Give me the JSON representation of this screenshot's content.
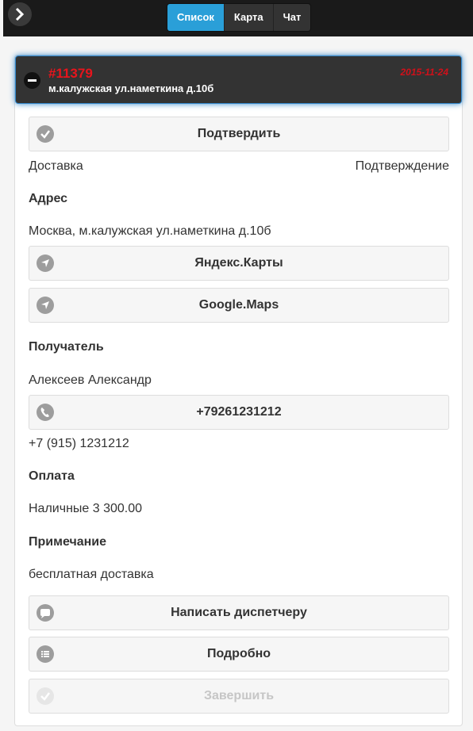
{
  "nav": {
    "tabs": [
      "Список",
      "Карта",
      "Чат"
    ]
  },
  "order": {
    "number": "#11379",
    "date": "2015-11-24",
    "address_short": "м.калужская ул.наметкина д.10б"
  },
  "actions": {
    "confirm": "Подтвердить",
    "yandex": "Яндекс.Карты",
    "google": "Google.Maps",
    "phone": "+79261231212",
    "message": "Написать диспетчеру",
    "details": "Подробно",
    "finish": "Завершить"
  },
  "details": {
    "type": "Доставка",
    "status": "Подтверждение",
    "address_label": "Адрес",
    "address_value": "Москва, м.калужская ул.наметкина д.10б",
    "recipient_label": "Получатель",
    "recipient_value": "Алексеев Александр",
    "phone_alt": "+7 (915) 1231212",
    "payment_label": "Оплата",
    "payment_value": "Наличные 3 300.00",
    "note_label": "Примечание",
    "note_value": "бесплатная доставка"
  },
  "colors": {
    "accent": "#2a9fd8",
    "alert": "#e8141c",
    "header": "#333333"
  },
  "icons": [
    "chevron-right-icon",
    "minus-icon",
    "check-icon",
    "location-arrow-icon",
    "phone-icon",
    "chat-bubble-icon",
    "list-icon"
  ]
}
